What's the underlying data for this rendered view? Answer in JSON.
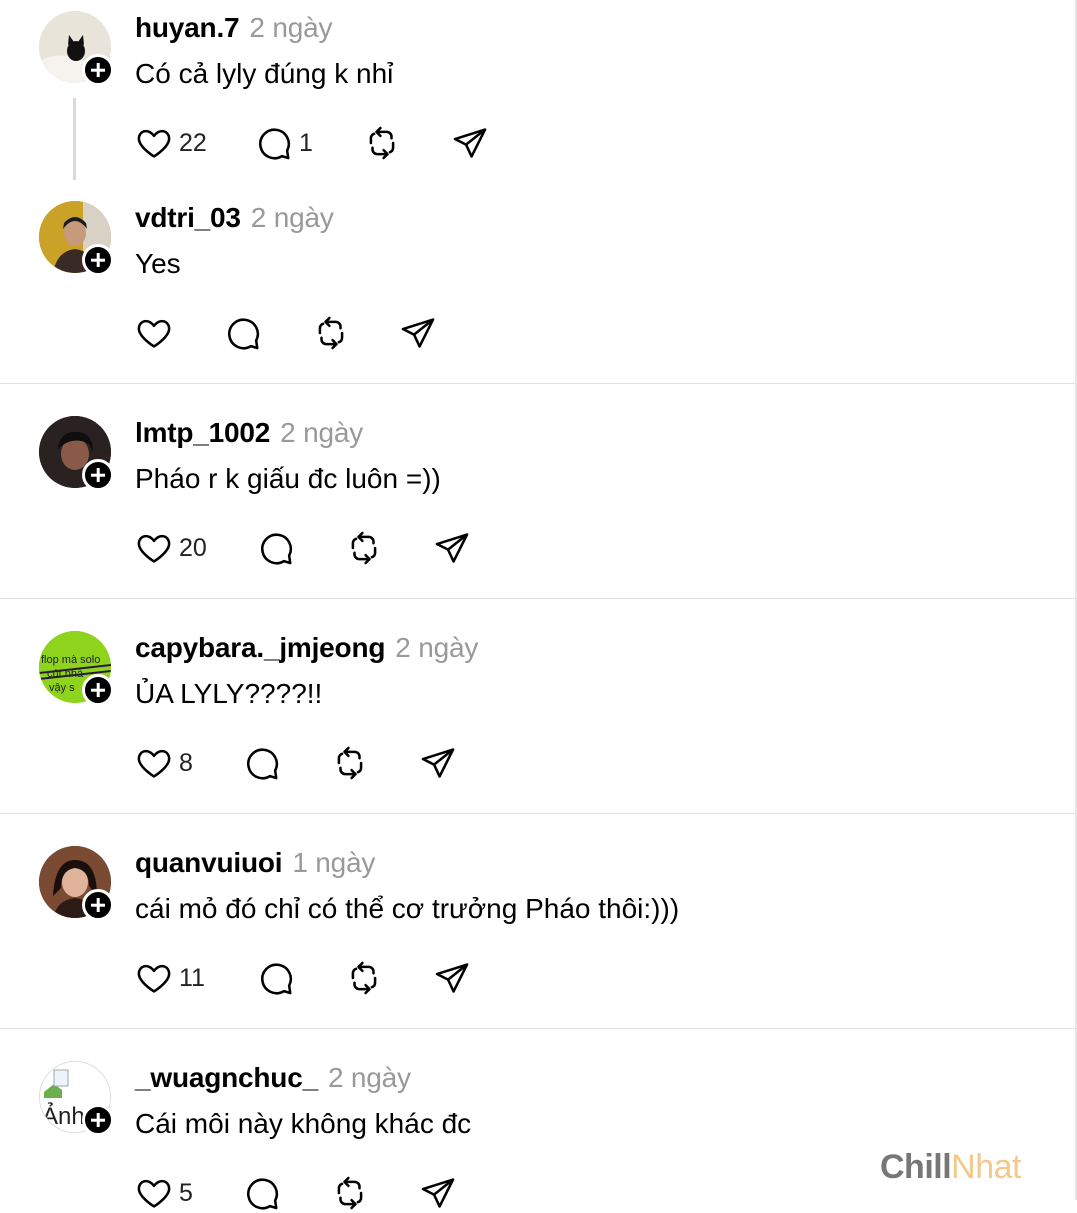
{
  "posts": [
    {
      "username": "huyan.7",
      "time": "2 ngày",
      "text": "Có cả lyly đúng k nhỉ",
      "likes": "22",
      "replies": "1"
    },
    {
      "username": "vdtri_03",
      "time": "2 ngày",
      "text": "Yes",
      "likes": "",
      "replies": ""
    },
    {
      "username": "lmtp_1002",
      "time": "2 ngày",
      "text": "Pháo r k giấu đc luôn =))",
      "likes": "20",
      "replies": ""
    },
    {
      "username": "capybara._jmjeong",
      "time": "2 ngày",
      "text": "ỦA LYLY????!!",
      "likes": "8",
      "replies": "",
      "avatar_text": [
        "flop mà solo",
        "cút nhà",
        "vậy s"
      ]
    },
    {
      "username": "quanvuiuoi",
      "time": "1 ngày",
      "text": "cái mỏ đó chỉ có thể cơ trưởng Pháo thôi:)))",
      "likes": "11",
      "replies": ""
    },
    {
      "username": "_wuagnchuc_",
      "time": "2 ngày",
      "text": "Cái môi này không khác đc",
      "likes": "5",
      "replies": "",
      "avatar_alt": "Ảnh"
    }
  ],
  "watermark": {
    "part1": "Chill",
    "part2": "Nhat"
  },
  "icons": [
    "heart-icon",
    "comment-icon",
    "repost-icon",
    "share-icon",
    "follow-plus-icon"
  ]
}
